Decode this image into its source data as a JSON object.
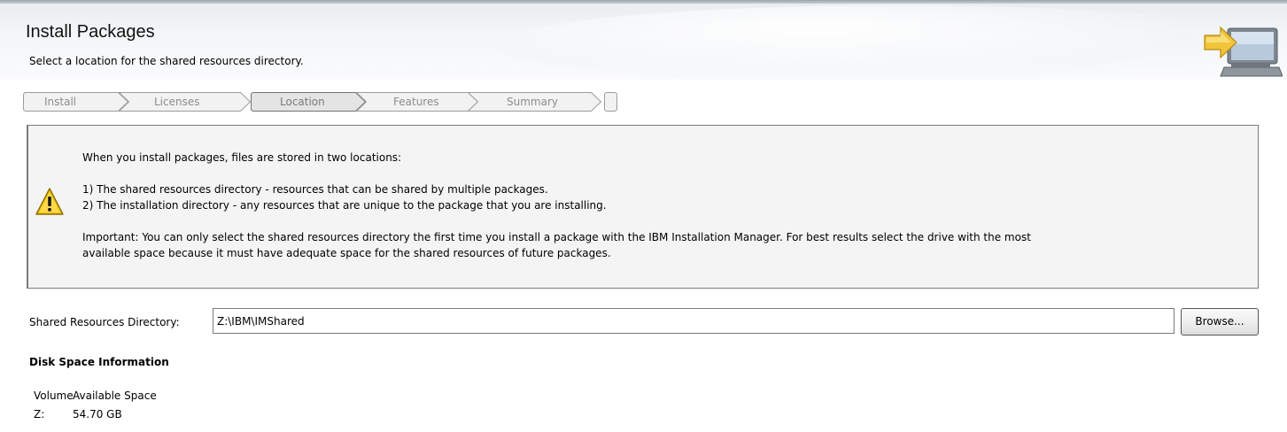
{
  "header": {
    "title": "Install Packages",
    "subtitle": "Select a location for the shared resources directory."
  },
  "wizard": {
    "steps": [
      {
        "label": "Install",
        "active": false
      },
      {
        "label": "Licenses",
        "active": false
      },
      {
        "label": "Location",
        "active": true
      },
      {
        "label": "Features",
        "active": false
      },
      {
        "label": "Summary",
        "active": false
      }
    ]
  },
  "info": {
    "line1": "When you install packages, files are stored in two locations:",
    "line2": "1) The shared resources directory - resources that can be shared by multiple packages.",
    "line3": "2) The installation directory - any resources that are unique to the package that you are installing.",
    "line4": "Important: You can only select the shared resources directory the first time you install a package with the IBM Installation Manager. For best results select the drive with the most",
    "line5": "available space because it must have adequate space for the shared resources of future packages."
  },
  "directory": {
    "label": "Shared Resources Directory:",
    "value": "Z:\\IBM\\IMShared",
    "browse_label": "Browse..."
  },
  "disk": {
    "heading": "Disk Space Information",
    "columns": [
      "Volume",
      "Available Space"
    ],
    "rows": [
      {
        "volume": "Z:",
        "available": "54.70 GB"
      }
    ]
  },
  "colors": {
    "step_active_fill": "#e4e4e4",
    "step_inactive_fill": "#f2f2f2",
    "step_text": "#8c8c8c",
    "warning_yellow": "#f5c400"
  },
  "icons": {
    "banner": "install-computer-arrow-icon",
    "warning": "warning-triangle-icon"
  }
}
